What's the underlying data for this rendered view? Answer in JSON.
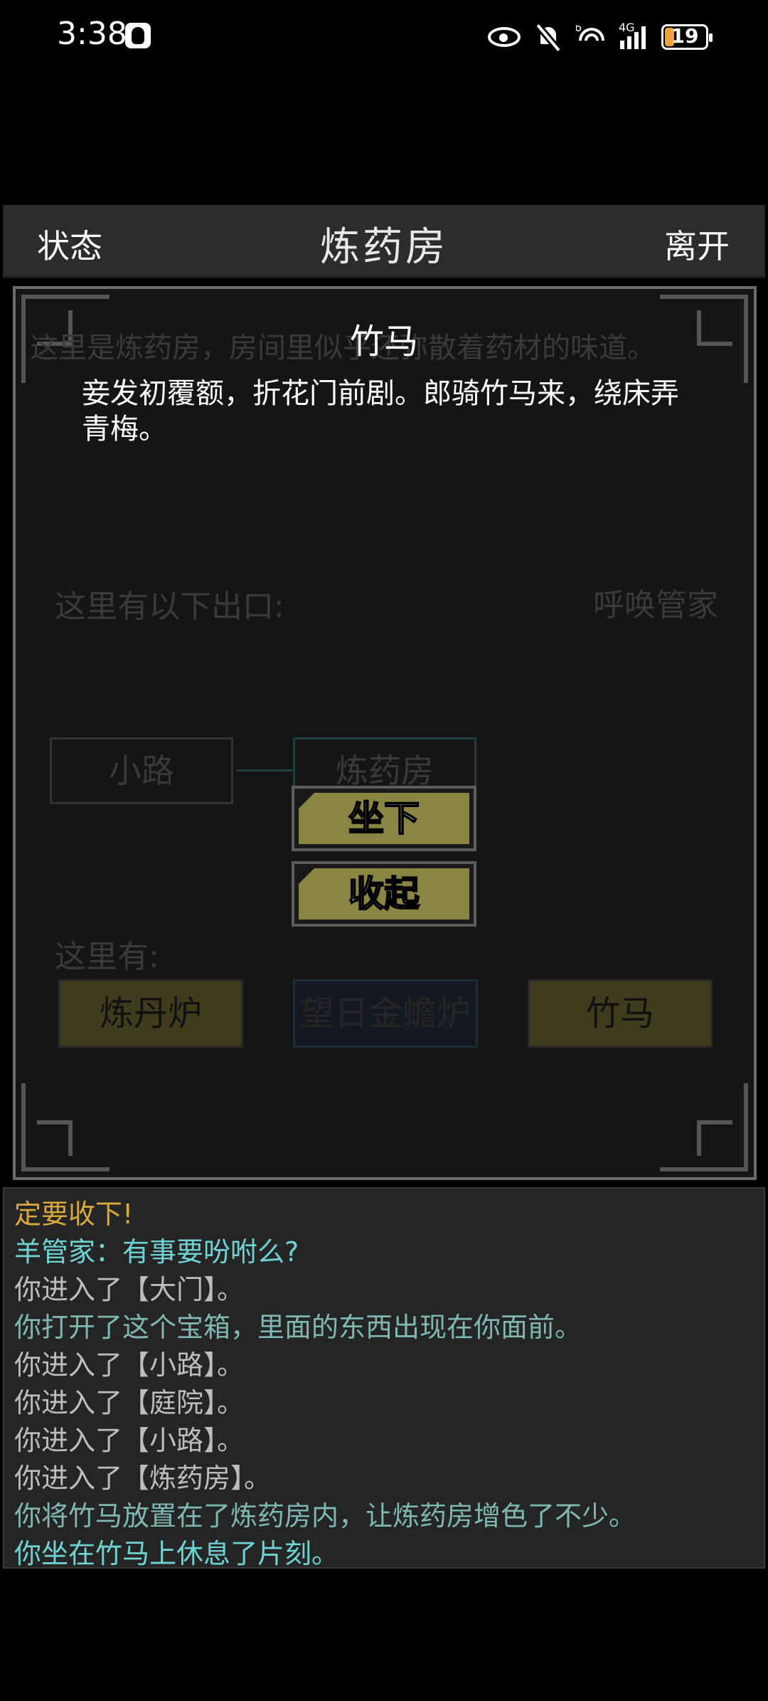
{
  "status_bar": {
    "time": "3:38",
    "network_label": "4G",
    "wifi_label": "6",
    "battery_level": "19",
    "battery_color": "#f2a23a"
  },
  "header": {
    "left_button": "状态",
    "title": "炼药房",
    "right_button": "离开"
  },
  "room": {
    "description": "这里是炼药房，房间里似乎还弥散着药材的味道。",
    "exits_label": "这里有以下出口:",
    "summon_label": "呼唤管家",
    "map_rooms": [
      {
        "label": "小路"
      },
      {
        "label": "炼药房"
      }
    ],
    "here_label": "这里有:",
    "items": [
      {
        "label": "炼丹炉"
      },
      {
        "label": "望日金蟾炉"
      },
      {
        "label": "竹马"
      }
    ]
  },
  "popup": {
    "title": "竹马",
    "body": "妾发初覆额，折花门前剧。郎骑竹马来，绕床弄青梅。",
    "actions": [
      {
        "label": "坐下"
      },
      {
        "label": "收起"
      }
    ],
    "button_color": "#8a8542"
  },
  "log": {
    "lines": [
      {
        "text": "定要收下!",
        "color": "#d9a83c"
      },
      {
        "text": "羊管家：有事要吩咐么?",
        "color": "#6fd3d3"
      },
      {
        "text": "你进入了【大门】。",
        "color": "#bdbdbd"
      },
      {
        "text": "你打开了这个宝箱，里面的东西出现在你面前。",
        "color": "#7fb8b3"
      },
      {
        "text": "你进入了【小路】。",
        "color": "#bdbdbd"
      },
      {
        "text": "你进入了【庭院】。",
        "color": "#bdbdbd"
      },
      {
        "text": "你进入了【小路】。",
        "color": "#bdbdbd"
      },
      {
        "text": "你进入了【炼药房】。",
        "color": "#bdbdbd"
      },
      {
        "text": "你将竹马放置在了炼药房内，让炼药房增色了不少。",
        "color": "#7fb8b3"
      },
      {
        "text": "你坐在竹马上休息了片刻。",
        "color": "#6fd3d3"
      }
    ]
  }
}
